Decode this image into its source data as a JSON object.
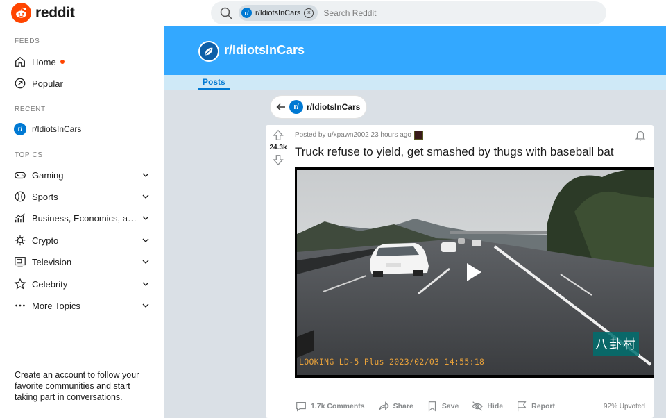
{
  "brand": {
    "name": "reddit",
    "icon": "reddit-snoo-icon",
    "color": "#ff4500"
  },
  "search": {
    "chip_label": "r/IdiotsInCars",
    "chip_icon": "r/",
    "placeholder": "Search Reddit"
  },
  "sidebar": {
    "feeds_label": "FEEDS",
    "feeds": [
      {
        "label": "Home",
        "icon": "home-icon"
      },
      {
        "label": "Popular",
        "icon": "popular-arrow-icon"
      }
    ],
    "recent_label": "RECENT",
    "recent": [
      {
        "label": "r/IdiotsInCars",
        "icon_text": "r/"
      }
    ],
    "topics_label": "TOPICS",
    "topics": [
      {
        "label": "Gaming",
        "icon": "gamepad-icon"
      },
      {
        "label": "Sports",
        "icon": "ball-icon"
      },
      {
        "label": "Business, Economics, and Finance",
        "icon": "chart-icon"
      },
      {
        "label": "Crypto",
        "icon": "crypto-icon"
      },
      {
        "label": "Television",
        "icon": "tv-icon"
      },
      {
        "label": "Celebrity",
        "icon": "star-icon"
      },
      {
        "label": "More Topics",
        "icon": "ellipsis-icon"
      }
    ],
    "cta": "Create an account to follow your favorite communities and start taking part in conversations."
  },
  "community": {
    "name": "r/IdiotsInCars",
    "banner_color": "#33a8ff",
    "tab": "Posts",
    "back_label": "r/IdiotsInCars",
    "back_icon_text": "r/"
  },
  "post": {
    "vote_count": "24.3k",
    "meta": "Posted by u/xpawn2002 23 hours ago",
    "title": "Truck refuse to yield, get smashed by thugs with baseball bat",
    "video": {
      "overlay_text": "八卦村",
      "timestamp": "LOOKING LD-5 Plus 2023/02/03 14:55:18"
    },
    "actions": {
      "comments": "1.7k Comments",
      "share": "Share",
      "save": "Save",
      "hide": "Hide",
      "report": "Report"
    },
    "upvoted": "92% Upvoted"
  }
}
